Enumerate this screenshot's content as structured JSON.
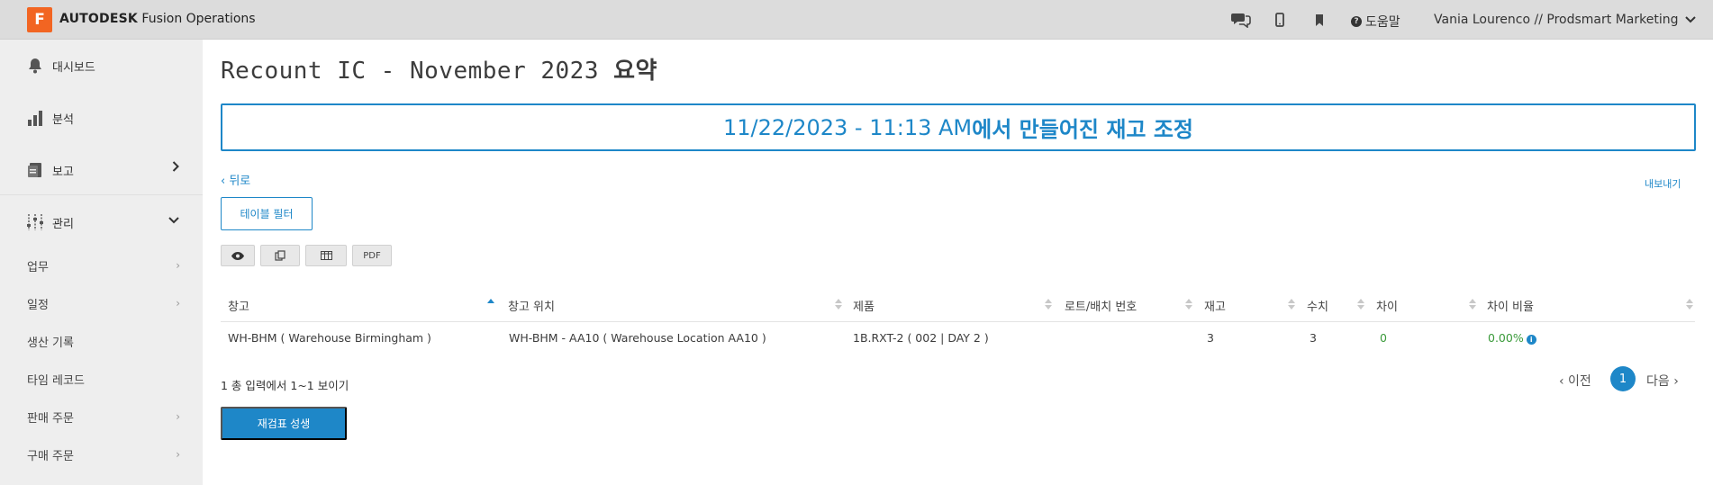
{
  "app": {
    "logo_letter": "F",
    "brand_bold": "AUTODESK",
    "brand_rest": " Fusion Operations",
    "help_label": "도움말",
    "user_label": "Vania Lourenco // Prodsmart Marketing"
  },
  "sidebar": {
    "main_items": [
      {
        "label": "대시보드",
        "icon": "bell-icon"
      },
      {
        "label": "분석",
        "icon": "bar-chart-icon"
      },
      {
        "label": "보고",
        "icon": "report-icon"
      },
      {
        "label": "관리",
        "icon": "sliders-icon"
      }
    ],
    "sub_items": [
      {
        "label": "업무"
      },
      {
        "label": "일정"
      },
      {
        "label": "생산 기록"
      },
      {
        "label": "타임 레코드"
      },
      {
        "label": "판매 주문"
      },
      {
        "label": "구매 주문"
      }
    ]
  },
  "page": {
    "title_main": "Recount IC - November 2023 ",
    "title_suffix": "요약",
    "banner_date": "11/22/2023 - 11:13 AM",
    "banner_text": "에서 만들어진 재고 조정",
    "back_label": "‹ 뒤로",
    "export_label": "내보내기",
    "filter_label": "테이블 필터",
    "pdf_label": "PDF"
  },
  "table": {
    "headers": [
      "창고",
      "창고 위치",
      "제품",
      "로트/배치 번호",
      "재고",
      "수치",
      "차이",
      "차이 비율"
    ],
    "rows": [
      [
        "WH-BHM ( Warehouse Birmingham )",
        "WH-BHM - AA10 ( Warehouse Location AA10 )",
        "1B.RXT-2 ( 002 | DAY 2 )",
        "",
        "3",
        "3",
        "0",
        "0.00%"
      ]
    ]
  },
  "footer": {
    "entries_text": "1 총 입력에서 1~1 보이기",
    "prev_label": "‹ 이전",
    "current_page": "1",
    "next_label": "다음 ›",
    "generate_label": "재검표 성생"
  },
  "colors": {
    "accent": "#1e87c8",
    "logo": "#f26522",
    "positive": "#3a9a3a"
  }
}
